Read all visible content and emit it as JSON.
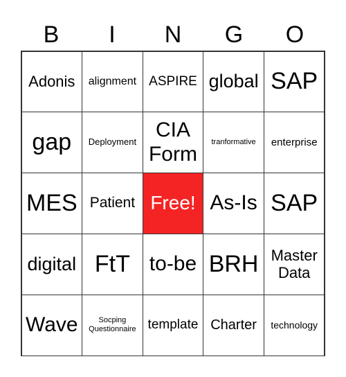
{
  "header": [
    "B",
    "I",
    "N",
    "G",
    "O"
  ],
  "cells": [
    [
      "Adonis",
      "alignment",
      "ASPIRE",
      "global",
      "SAP"
    ],
    [
      "gap",
      "Deployment",
      "CIA Form",
      "tranformative",
      "enterprise"
    ],
    [
      "MES",
      "Patient",
      "Free!",
      "As-Is",
      "SAP"
    ],
    [
      "digital",
      "FtT",
      "to-be",
      "BRH",
      "Master Data"
    ],
    [
      "Wave",
      "Socping Questionnaire",
      "template",
      "Charter",
      "technology"
    ]
  ],
  "free_cell_color": "#f52424"
}
